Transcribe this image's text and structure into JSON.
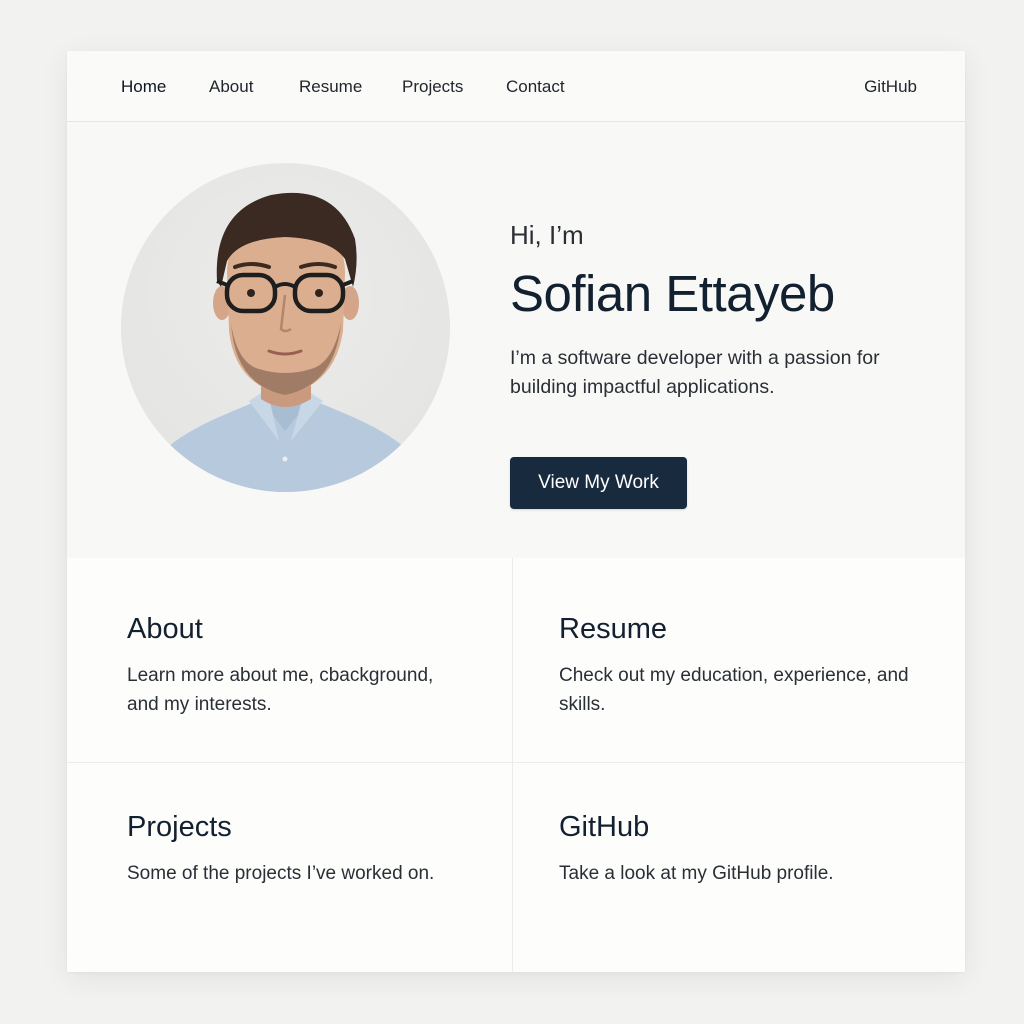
{
  "nav": {
    "links": [
      {
        "label": "Home"
      },
      {
        "label": "About"
      },
      {
        "label": "Resume"
      },
      {
        "label": "Projects"
      },
      {
        "label": "Contact"
      }
    ],
    "github_label": "GitHub"
  },
  "hero": {
    "greeting": "Hi, I’m",
    "name": "Sofian Ettayeb",
    "tagline": "I’m a software developer with a passion for building impactful applications.",
    "cta_label": "View My Work",
    "avatar_alt": "portrait"
  },
  "cards": [
    {
      "title": "About",
      "description": "Learn more about me, cbackground, and my interests."
    },
    {
      "title": "Resume",
      "description": "Check out my education, experience, and skills."
    },
    {
      "title": "Projects",
      "description": "Some of the projects I’ve worked on."
    },
    {
      "title": "GitHub",
      "description": "Take a look at my GitHub profile."
    }
  ],
  "colors": {
    "accent": "#172a3e",
    "text": "#13202f",
    "background": "#f2f2f1"
  }
}
